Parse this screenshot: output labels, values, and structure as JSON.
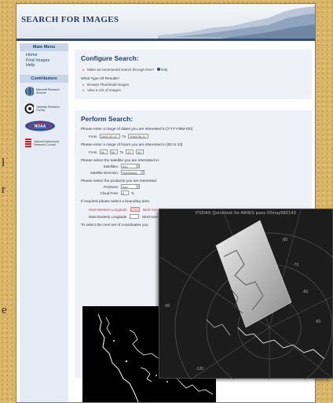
{
  "edge_glyphs": [
    "l",
    "r",
    "e"
  ],
  "banner": {
    "title": "SEARCH FOR IMAGES"
  },
  "sidebar": {
    "menu_title": "Main Menu",
    "menu_items": [
      "Home",
      "Find Images",
      "Help"
    ],
    "contributors_title": "Contributors",
    "logos": [
      {
        "icon": "globe-logo",
        "text": "Microsoft Research Sensors"
      },
      {
        "icon": "ring-logo",
        "text": "Antarctic Research Survey"
      },
      {
        "icon": "nasa-logo",
        "text": "NOAA"
      },
      {
        "icon": "stripes-logo",
        "text": "Natural Environment Research Council"
      }
    ]
  },
  "configure": {
    "title": "Configure Search:",
    "incremental": "Make an incremental search through time?",
    "help": "help",
    "result_question": "What Type Of Results?",
    "result_options": [
      "Browse Thumbnail Images",
      "View a List of Images"
    ]
  },
  "perform": {
    "title": "Perform Search:",
    "date_prompt": "Please enter a range of dates you are interested in [YYYY-MM-DD]",
    "from_label": "From",
    "to_label": "To",
    "date_from": "2003-02-07",
    "date_to": "2003-06-11",
    "hour_prompt": "Please enter a range of hours you are interested in [00 to 23]",
    "hour_from": "00",
    "hour_from2": "59",
    "hour_to": "23",
    "hour_to2": "59",
    "satellite_prompt": "Please select the satellite you are interested in:",
    "satellites_label": "Satellites:",
    "satellites_value": "ALL",
    "direction_label": "Satellite Direction:",
    "direction_value": "Northward",
    "products_prompt": "Please select the products you are interested",
    "products_label": "Products:",
    "products_value": "ALL",
    "cloud_label": "Cloud Free:",
    "cloud_value": "0",
    "cloud_unit": "%",
    "bbox_prompt": "If required please select a bounding area",
    "west_label": "Most Western Longitude",
    "south_label": "Most Sou",
    "east_label": "Most Easterly Longitude",
    "north_label": "Most Nort",
    "map_prompt": "To select the next set of coordinates you"
  },
  "overlay": {
    "title": "PSDAS Quicklook for ARIES pass 02may982143",
    "lat_labels": [
      "-80",
      "-70",
      "-60"
    ],
    "lon_labels": [
      "-90",
      "-120",
      "-60",
      "-150",
      "150",
      "180",
      "-30"
    ]
  }
}
